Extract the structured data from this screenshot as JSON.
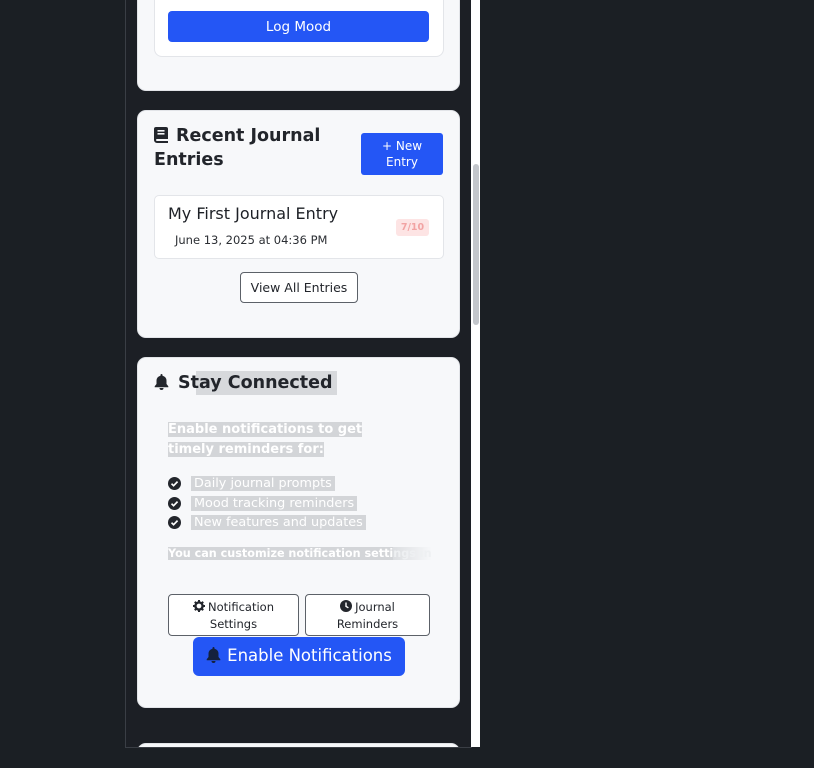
{
  "mood": {
    "log_button": "Log Mood"
  },
  "journal": {
    "title": "Recent Journal Entries",
    "new_entry_label": "New Entry",
    "entries": [
      {
        "title": "My First Journal Entry",
        "date": "June 13, 2025 at 04:36 PM",
        "score": "7/10"
      }
    ],
    "view_all_label": "View All Entries"
  },
  "connect": {
    "title": "Stay Connected",
    "intro": "Enable notifications to get timely reminders for:",
    "bullets": [
      "Daily journal prompts",
      "Mood tracking reminders",
      "New features and updates"
    ],
    "customize_visible": "You can customize notification setti",
    "customize_faded": "ngs in",
    "notification_settings_label": "Notification Settings",
    "journal_reminders_label": "Journal Reminders",
    "enable_label": "Enable Notifications"
  },
  "colors": {
    "primary": "#2456f5",
    "background": "#1b1f24",
    "card": "#f7f8fa"
  },
  "icons": [
    "book-icon",
    "plus-icon",
    "bell-icon",
    "check-circle-icon",
    "gear-icon",
    "clock-icon"
  ]
}
